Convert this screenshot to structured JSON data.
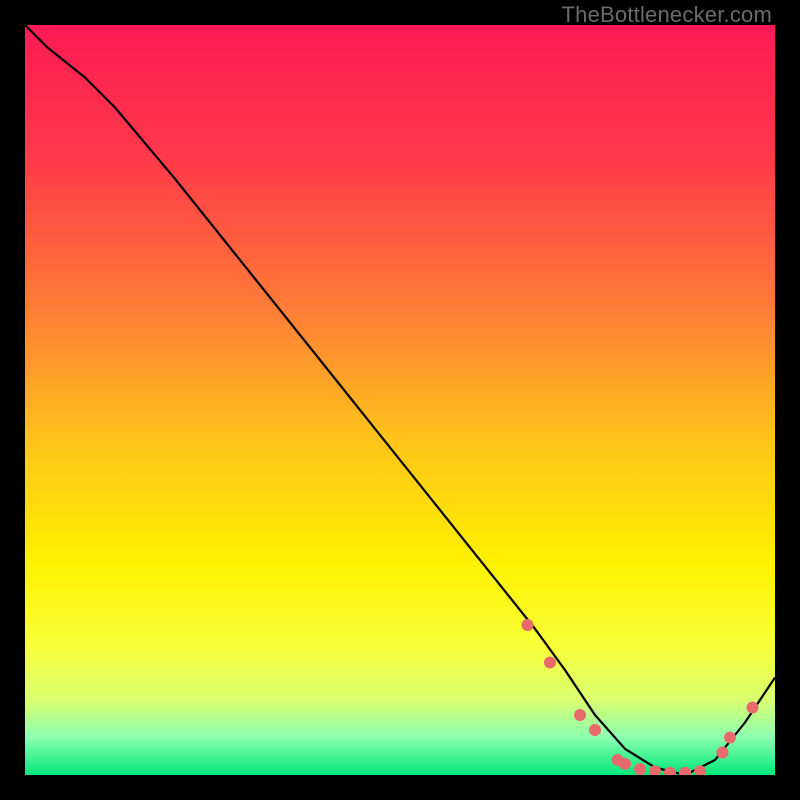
{
  "watermark": "TheBottlenecker.com",
  "chart_data": {
    "type": "line",
    "title": "",
    "xlabel": "",
    "ylabel": "",
    "xlim": [
      0,
      100
    ],
    "ylim": [
      0,
      100
    ],
    "grid": false,
    "series": [
      {
        "name": "curve",
        "x": [
          0,
          3,
          8,
          12,
          20,
          30,
          40,
          50,
          60,
          68,
          72,
          76,
          80,
          84,
          88,
          92,
          96,
          100
        ],
        "y": [
          100,
          97,
          93,
          89,
          79.5,
          67,
          54.5,
          42,
          29.5,
          19.5,
          14,
          8,
          3.5,
          1,
          0,
          2,
          7,
          13
        ]
      }
    ],
    "markers": {
      "name": "points",
      "color": "#e86a6a",
      "x": [
        67,
        70,
        74,
        76,
        79,
        80,
        82,
        84,
        86,
        88,
        90,
        93,
        94,
        97
      ],
      "y": [
        20,
        15,
        8,
        6,
        2,
        1.5,
        0.8,
        0.5,
        0.3,
        0.3,
        0.5,
        3,
        5,
        9
      ]
    },
    "gradient_stops": [
      {
        "offset": 0.0,
        "color": "#ff1a55"
      },
      {
        "offset": 0.18,
        "color": "#ff3a49"
      },
      {
        "offset": 0.38,
        "color": "#ff7d36"
      },
      {
        "offset": 0.55,
        "color": "#ffc21a"
      },
      {
        "offset": 0.72,
        "color": "#fff200"
      },
      {
        "offset": 0.83,
        "color": "#f7ff3a"
      },
      {
        "offset": 0.9,
        "color": "#d9ff70"
      },
      {
        "offset": 0.95,
        "color": "#8cffb0"
      },
      {
        "offset": 1.0,
        "color": "#00e87a"
      }
    ]
  }
}
